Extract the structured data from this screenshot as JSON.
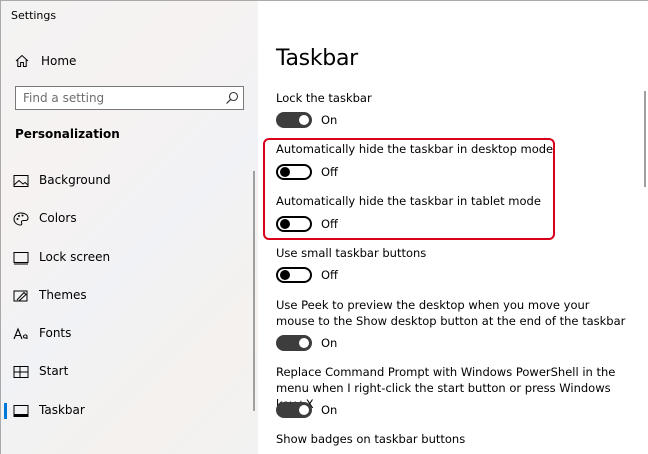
{
  "window": {
    "title": "Settings"
  },
  "sidebar": {
    "home_label": "Home",
    "search_placeholder": "Find a setting",
    "section_title": "Personalization",
    "items": [
      {
        "label": "Background",
        "icon": "image-icon"
      },
      {
        "label": "Colors",
        "icon": "palette-icon"
      },
      {
        "label": "Lock screen",
        "icon": "lock-screen-icon"
      },
      {
        "label": "Themes",
        "icon": "themes-icon"
      },
      {
        "label": "Fonts",
        "icon": "fonts-icon"
      },
      {
        "label": "Start",
        "icon": "start-icon"
      },
      {
        "label": "Taskbar",
        "icon": "taskbar-icon",
        "selected": true
      }
    ]
  },
  "content": {
    "title": "Taskbar",
    "settings": [
      {
        "label": "Lock the taskbar",
        "state": "On"
      },
      {
        "label": "Automatically hide the taskbar in desktop mode",
        "state": "Off"
      },
      {
        "label": "Automatically hide the taskbar in tablet mode",
        "state": "Off"
      },
      {
        "label": "Use small taskbar buttons",
        "state": "Off"
      },
      {
        "label": "Use Peek to preview the desktop when you move your mouse to the Show desktop button at the end of the taskbar",
        "state": "On"
      },
      {
        "label": "Replace Command Prompt with Windows PowerShell in the menu when I right-click the start button or press Windows key+X",
        "state": "On"
      },
      {
        "label": "Show badges on taskbar buttons"
      }
    ]
  },
  "colors": {
    "accent": "#0078d7",
    "highlight": "#d9001b",
    "toggle_on": "#3d3d3d"
  }
}
